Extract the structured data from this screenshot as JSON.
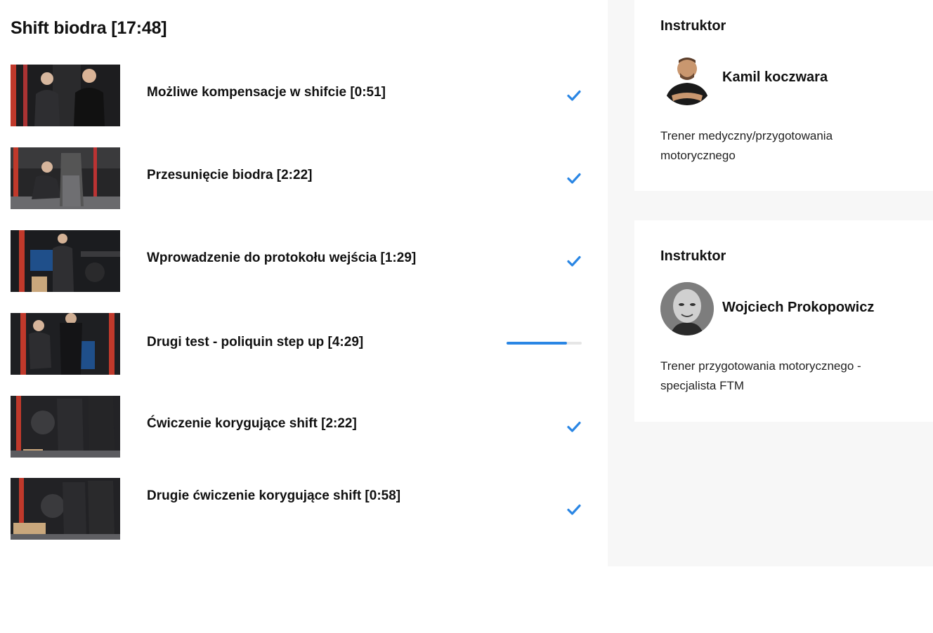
{
  "section": {
    "title": "Shift biodra [17:48]"
  },
  "lessons": [
    {
      "title": "Możliwe kompensacje w shifcie [0:51]",
      "status": "completed"
    },
    {
      "title": "Przesunięcie biodra [2:22]",
      "status": "completed"
    },
    {
      "title": "Wprowadzenie do protokołu wejścia [1:29]",
      "status": "completed"
    },
    {
      "title": "Drugi test - poliquin step up [4:29]",
      "status": "in-progress",
      "progress": 0.8
    },
    {
      "title": "Ćwiczenie korygujące shift [2:22]",
      "status": "completed"
    },
    {
      "title": "Drugie ćwiczenie korygujące shift [0:58]",
      "status": "completed"
    }
  ],
  "instructors": [
    {
      "heading": "Instruktor",
      "name": "Kamil koczwara",
      "description": "Trener medyczny/przygotowania motorycznego"
    },
    {
      "heading": "Instruktor",
      "name": "Wojciech Prokopowicz",
      "description": "Trener przygotowania motorycznego - specjalista FTM"
    }
  ],
  "colors": {
    "accent": "#2a86e4",
    "sidebar_bg": "#f7f7f7",
    "text": "#111111"
  },
  "icons": {
    "completed": "checkmark-icon"
  }
}
